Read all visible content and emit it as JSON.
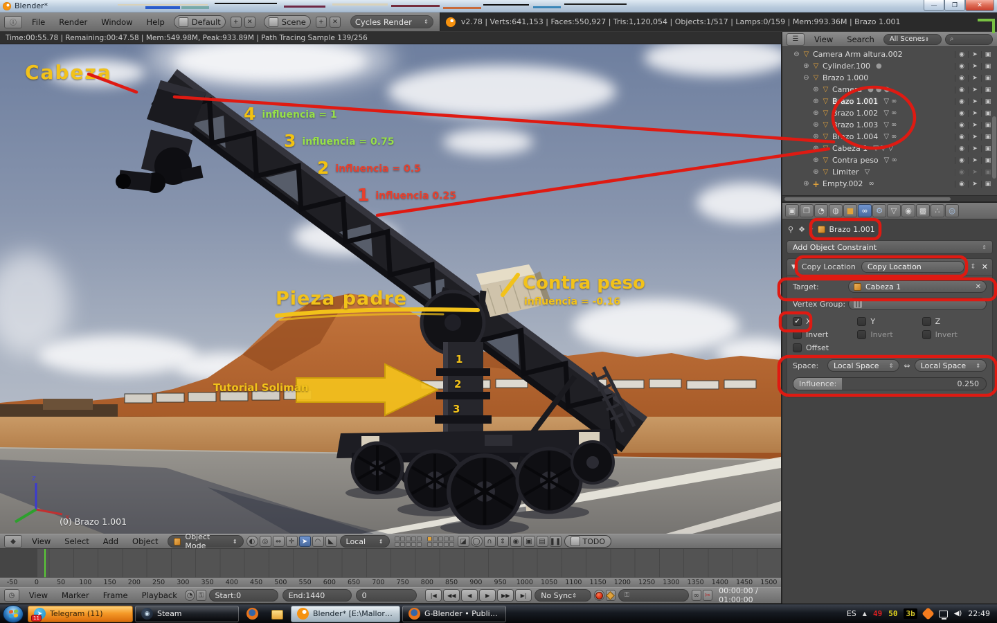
{
  "window": {
    "title": "Blender*"
  },
  "info_header": {
    "menus": [
      "File",
      "Render",
      "Window",
      "Help"
    ],
    "layout": "Default",
    "scene": "Scene",
    "engine": "Cycles Render",
    "stats": "v2.78 | Verts:641,153 | Faces:550,927 | Tris:1,120,054 | Objects:1/517 | Lamps:0/159 | Mem:993.36M | Brazo 1.001"
  },
  "render_status": "Time:00:55.78 | Remaining:00:47.58 | Mem:549.98M, Peak:933.89M | Path Tracing Sample 139/256",
  "viewport": {
    "object_info": "(0) Brazo 1.001",
    "axis_labels": {
      "x": "x",
      "z": "z"
    },
    "annotations": {
      "cabeza": "Cabeza",
      "influence_items": [
        {
          "num": "4",
          "text": "influencia = 1",
          "num_color": "#f2c211",
          "text_color": "#97e04a"
        },
        {
          "num": "3",
          "text": "influencia = 0.75",
          "num_color": "#f2c211",
          "text_color": "#97e04a"
        },
        {
          "num": "2",
          "text": "influencia = 0.5",
          "num_color": "#f2c211",
          "text_color": "#e8402d"
        },
        {
          "num": "1",
          "text": "influencia 0.25",
          "num_color": "#e8402d",
          "text_color": "#e8402d"
        }
      ],
      "pieza_padre": "Pieza padre",
      "contra_peso": "Contra peso",
      "contra_peso_sub": "influencia =  -0.16",
      "tutorial": "Tutorial Soliman",
      "column_numbers": [
        "1",
        "2",
        "3"
      ]
    }
  },
  "view3d_header": {
    "menus": [
      "View",
      "Select",
      "Add",
      "Object"
    ],
    "mode": "Object Mode",
    "orientation": "Local",
    "todo_label": "TODO"
  },
  "timeline": {
    "ruler": [
      "-50",
      "0",
      "50",
      "100",
      "150",
      "200",
      "250",
      "300",
      "350",
      "400",
      "450",
      "500",
      "550",
      "600",
      "650",
      "700",
      "750",
      "800",
      "850",
      "900",
      "950",
      "1000",
      "1050",
      "1100",
      "1150",
      "1200",
      "1250",
      "1300",
      "1350",
      "1400",
      "1450",
      "1500"
    ],
    "menus": [
      "View",
      "Marker",
      "Frame",
      "Playback"
    ],
    "start_label": "Start:",
    "start_value": "0",
    "end_label": "End:",
    "end_value": "1440",
    "current_frame": "0",
    "playback_buttons": [
      "jump-to-start",
      "prev-keyframe",
      "play-reverse",
      "play",
      "next-keyframe",
      "jump-to-end"
    ],
    "sync_mode": "No Sync",
    "timecode": "00:00:00 / 01:00:00"
  },
  "outliner": {
    "menus": [
      "View",
      "Search"
    ],
    "scenes_filter": "All Scenes",
    "rows": [
      {
        "label": "Camera Arm altura.002",
        "indent": 1,
        "expander": "-",
        "icon": "mesh-object",
        "extras": [],
        "selected": false,
        "dimmed": false
      },
      {
        "label": "Cylinder.100",
        "indent": 2,
        "expander": "+",
        "icon": "mesh-object",
        "extras": [
          "material"
        ],
        "selected": false,
        "dimmed": false
      },
      {
        "label": "Brazo 1.000",
        "indent": 2,
        "expander": "-",
        "icon": "mesh-object",
        "extras": [],
        "selected": false,
        "dimmed": false
      },
      {
        "label": "Camera",
        "indent": 3,
        "expander": "+",
        "icon": "mesh-object",
        "extras": [
          "material",
          "material",
          "material"
        ],
        "selected": false,
        "dimmed": false
      },
      {
        "label": "Brazo 1.001",
        "indent": 3,
        "expander": "+",
        "icon": "mesh-object",
        "extras": [
          "mesh-data",
          "link"
        ],
        "selected": true,
        "dimmed": false
      },
      {
        "label": "Brazo 1.002",
        "indent": 3,
        "expander": "+",
        "icon": "mesh-object",
        "extras": [
          "mesh-data",
          "link"
        ],
        "selected": false,
        "dimmed": false
      },
      {
        "label": "Brazo 1.003",
        "indent": 3,
        "expander": "+",
        "icon": "mesh-object",
        "extras": [
          "mesh-data",
          "link"
        ],
        "selected": false,
        "dimmed": false
      },
      {
        "label": "Brazo 1.004",
        "indent": 3,
        "expander": "+",
        "icon": "mesh-object",
        "extras": [
          "mesh-data",
          "link"
        ],
        "selected": false,
        "dimmed": false
      },
      {
        "label": "Cabeza 1",
        "indent": 3,
        "expander": "+",
        "icon": "mesh-object",
        "extras": [
          "mesh-data",
          "mesh-data",
          "mesh-data"
        ],
        "selected": false,
        "dimmed": false
      },
      {
        "label": "Contra peso",
        "indent": 3,
        "expander": "+",
        "icon": "mesh-object",
        "extras": [
          "mesh-data",
          "link"
        ],
        "selected": false,
        "dimmed": false
      },
      {
        "label": "Limiter",
        "indent": 3,
        "expander": "+",
        "icon": "mesh-object",
        "extras": [
          "mesh-data"
        ],
        "selected": false,
        "dimmed": true
      },
      {
        "label": "Empty.002",
        "indent": 2,
        "expander": "+",
        "icon": "empty-object",
        "extras": [
          "link"
        ],
        "selected": false,
        "dimmed": false
      }
    ]
  },
  "properties": {
    "tabs": [
      "render",
      "render-layers",
      "scene",
      "world",
      "object",
      "constraints",
      "modifiers",
      "object-data",
      "material",
      "texture",
      "particles",
      "physics"
    ],
    "active_tab": "constraints",
    "breadcrumb_object": "Brazo 1.001",
    "add_constraint_label": "Add Object Constraint",
    "constraint": {
      "type_label": "Copy Location",
      "name_value": "Copy Location",
      "target_label": "Target:",
      "target_value": "Cabeza 1",
      "vertex_group_label": "Vertex Group:",
      "axis_x": "X",
      "axis_y": "Y",
      "axis_z": "Z",
      "invert_label": "Invert",
      "offset_label": "Offset",
      "space_label": "Space:",
      "space_owner": "Local Space",
      "space_target": "Local Space",
      "influence_label": "Influence:",
      "influence_value": "0.250",
      "influence_percent": 25
    }
  },
  "taskbar": {
    "buttons": [
      {
        "label": "Telegram (11)",
        "icon": "telegram",
        "style": "orange",
        "badge": "11"
      },
      {
        "label": "Steam",
        "icon": "steam",
        "style": "dark"
      },
      {
        "label": "",
        "icon": "firefox",
        "style": "pinned"
      },
      {
        "label": "",
        "icon": "explorer",
        "style": "pinned"
      },
      {
        "label": "Blender* [E:\\Malloric...",
        "icon": "blender",
        "style": "light"
      },
      {
        "label": "G-Blender • Publicar ...",
        "icon": "firefox",
        "style": "dark"
      }
    ],
    "tray": {
      "language": "ES",
      "temp_red": "49",
      "temp_yellow": "50",
      "monitor_value": "3b",
      "clock": "22:49"
    }
  },
  "annotation_colors": {
    "red": "#df1a12",
    "yellow": "#f2c21a",
    "green_bracket": "#79c143"
  }
}
